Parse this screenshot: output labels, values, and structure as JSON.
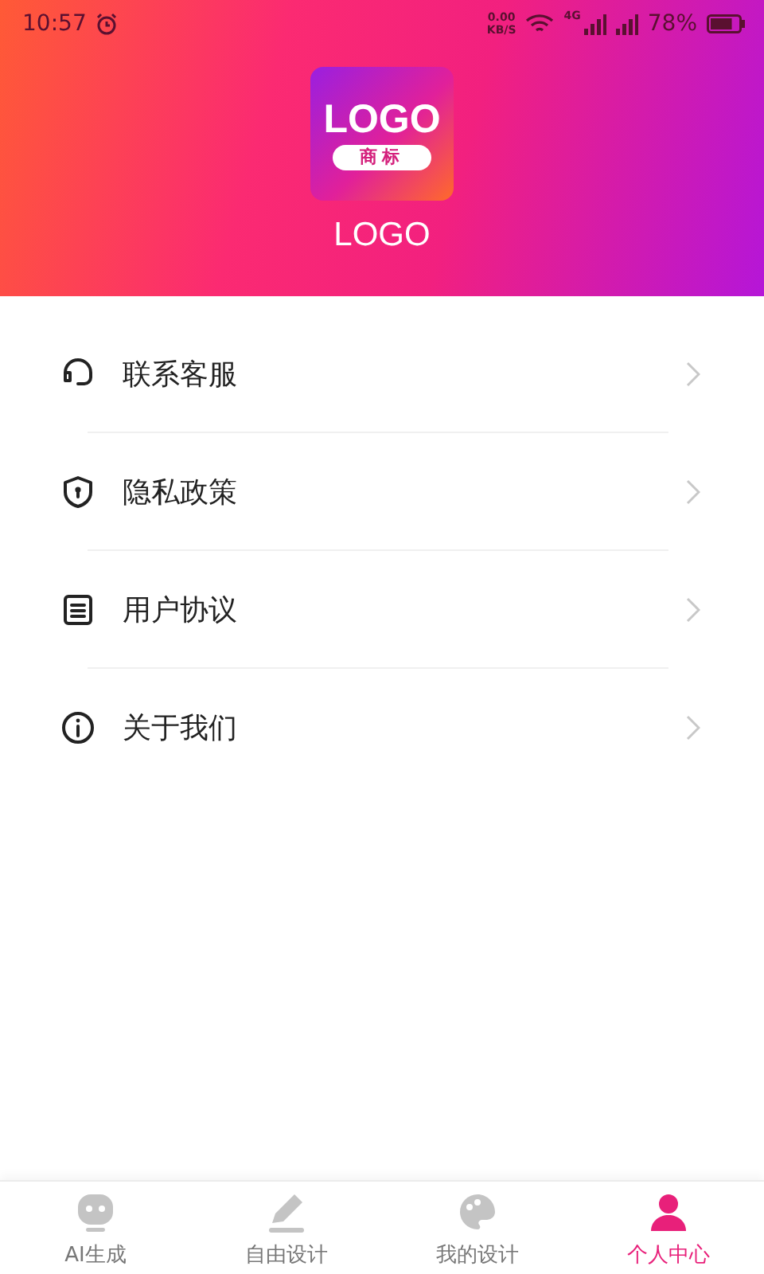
{
  "status_bar": {
    "time": "10:57",
    "net_speed": "0.00",
    "net_unit": "KB/S",
    "network": "4G",
    "battery_text": "78%",
    "battery": {
      "level": 0.78
    }
  },
  "header": {
    "logo_main": "LOGO",
    "logo_sub": "商标",
    "app_name": "LOGO"
  },
  "menu": [
    {
      "kind": "headset",
      "label": "联系客服"
    },
    {
      "kind": "shield",
      "label": "隐私政策"
    },
    {
      "kind": "document",
      "label": "用户协议"
    },
    {
      "kind": "info",
      "label": "关于我们"
    }
  ],
  "tabs": [
    {
      "kind": "robot",
      "label": "AI生成",
      "selected": false
    },
    {
      "kind": "pen",
      "label": "自由设计",
      "selected": false
    },
    {
      "kind": "design",
      "label": "我的设计",
      "selected": false
    },
    {
      "kind": "person",
      "label": "个人中心",
      "selected": true
    }
  ]
}
